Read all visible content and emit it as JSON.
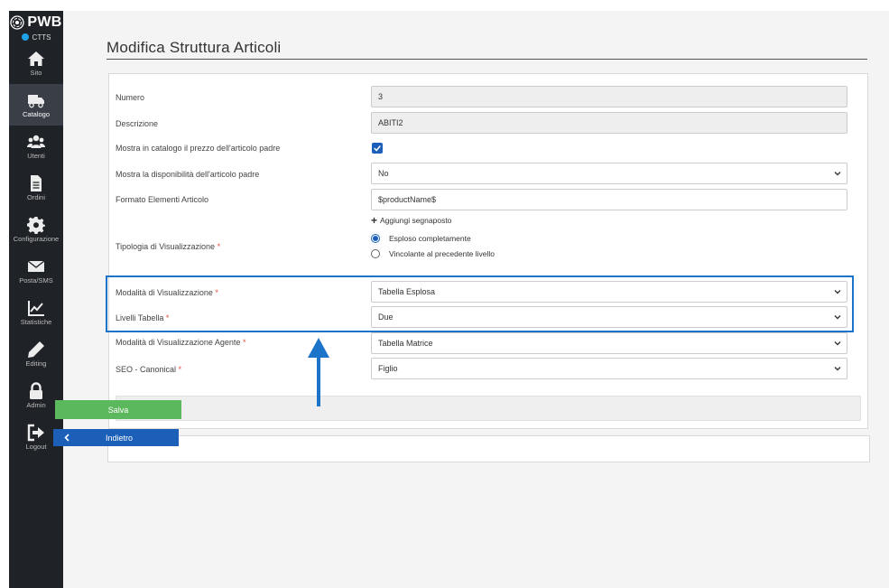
{
  "app": {
    "logo_text": "PWB",
    "site_label": "CTTS",
    "site_dot_color": "#1ea1e6"
  },
  "sidebar": {
    "items": [
      {
        "label": "Sito",
        "icon": "home-icon"
      },
      {
        "label": "Catalogo",
        "icon": "truck-icon",
        "active": true
      },
      {
        "label": "Utenti",
        "icon": "users-icon"
      },
      {
        "label": "Ordini",
        "icon": "document-icon"
      },
      {
        "label": "Configurazione",
        "icon": "gear-icon"
      },
      {
        "label": "Posta/SMS",
        "icon": "envelope-icon"
      },
      {
        "label": "Statistiche",
        "icon": "chart-icon"
      },
      {
        "label": "Editing",
        "icon": "pencil-icon"
      },
      {
        "label": "Admin",
        "icon": "lock-icon"
      },
      {
        "label": "Logout",
        "icon": "logout-icon"
      }
    ]
  },
  "page": {
    "title": "Modifica Struttura Articoli"
  },
  "form": {
    "numero": {
      "label": "Numero",
      "value": "3"
    },
    "descrizione": {
      "label": "Descrizione",
      "value": "ABITI2"
    },
    "mostra_prezzo": {
      "label": "Mostra in catalogo il prezzo dell'articolo padre",
      "checked": true
    },
    "mostra_disponibilita": {
      "label": "Mostra la disponibilità dell'articolo padre",
      "value": "No"
    },
    "formato": {
      "label": "Formato Elementi Articolo",
      "value": "$productName$",
      "add_link": "Aggiungi segnaposto"
    },
    "tipologia": {
      "label": "Tipologia di Visualizzazione",
      "required_mark": "*",
      "options": [
        "Esploso completamente",
        "Vincolante al precedente livello"
      ],
      "selected": 0
    },
    "modalita": {
      "label": "Modalità di Visualizzazione",
      "required_mark": "*",
      "value": "Tabella Esplosa"
    },
    "livelli": {
      "label": "Livelli Tabella",
      "required_mark": "*",
      "value": "Due"
    },
    "modalita_agente": {
      "label": "Modalità di Visualizzazione Agente",
      "required_mark": "*",
      "value": "Tabella Matrice"
    },
    "seo": {
      "label": "SEO - Canonical",
      "required_mark": "*",
      "value": "Figlio"
    }
  },
  "buttons": {
    "save": "Salva",
    "back": "Indietro"
  },
  "colors": {
    "primary": "#1b5fb8",
    "save": "#5cb85c",
    "highlight": "#1b74c9",
    "required": "#e74c3c",
    "sidebar": "#1f2227"
  }
}
